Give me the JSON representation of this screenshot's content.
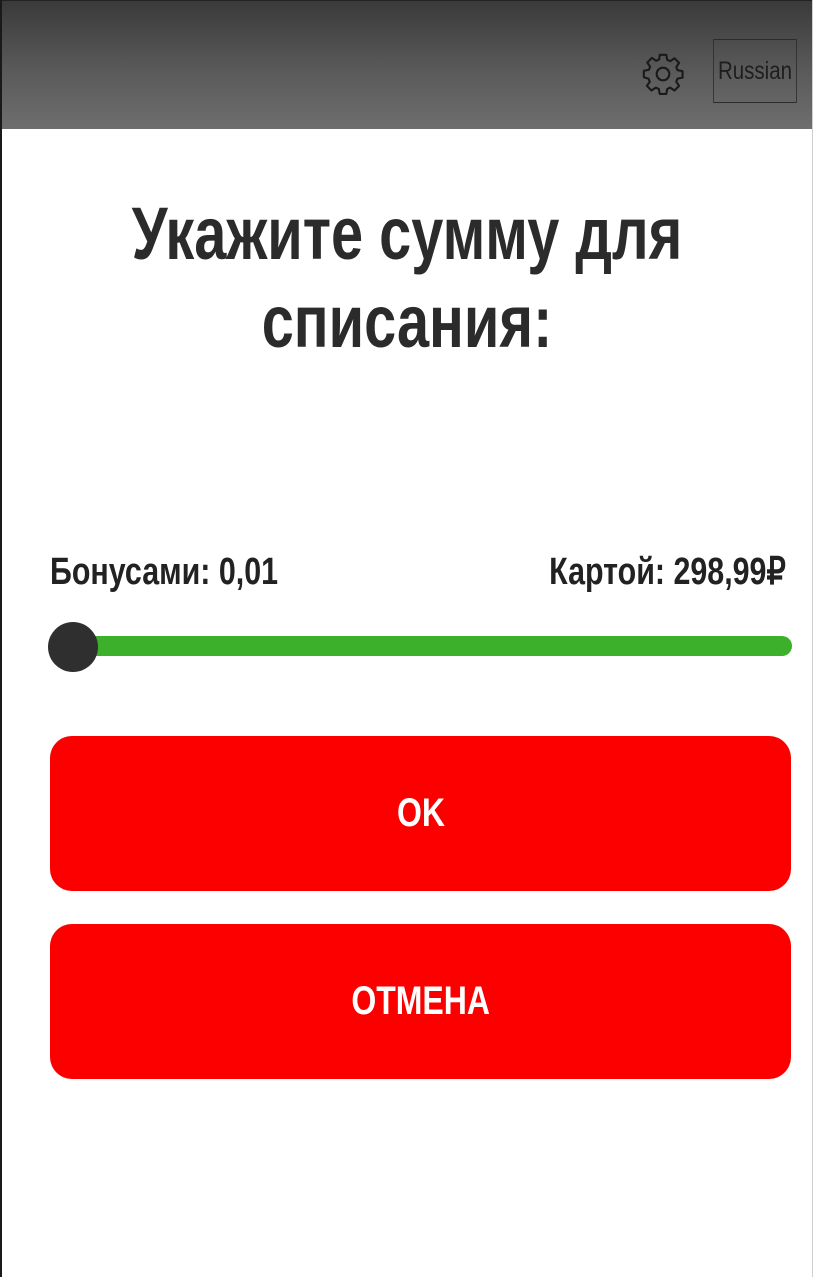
{
  "header": {
    "settings_icon": "gear-icon",
    "language_label": "Russian",
    "background_color": "#5a5a5a"
  },
  "dialog": {
    "title_line1": "Укажите сумму для",
    "title_line2": "списания:",
    "bonus_label": "Бонусами: 0,01",
    "card_label": "Картой: 298,99₽",
    "slider": {
      "value_fraction": 0.0,
      "track_color": "#3cb02a",
      "thumb_color": "#2f2f2f"
    },
    "ok_label": "OK",
    "cancel_label": "ОТМЕНА",
    "button_color": "#fc0000"
  }
}
